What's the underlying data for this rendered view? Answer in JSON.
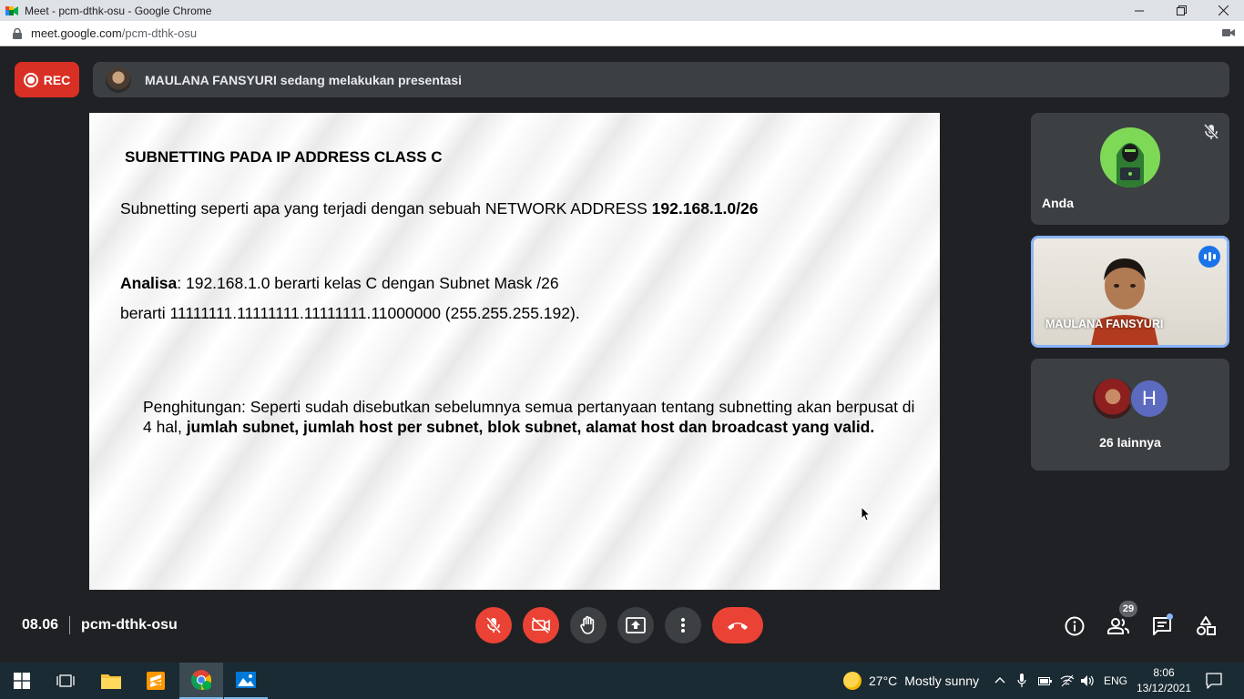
{
  "browser": {
    "window_title": "Meet - pcm-dthk-osu - Google Chrome",
    "url_host": "meet.google.com",
    "url_path": "/pcm-dthk-osu"
  },
  "meet": {
    "rec_label": "REC",
    "presenting_text": "MAULANA FANSYURI sedang melakukan presentasi",
    "time": "08.06",
    "meeting_code": "pcm-dthk-osu",
    "participants_count": "29"
  },
  "slide": {
    "title": "SUBNETTING PADA IP ADDRESS CLASS C",
    "line1_normal": "Subnetting seperti apa yang terjadi dengan sebuah NETWORK ADDRESS ",
    "line1_bold": "192.168.1.0/26",
    "line2_bold": "Analisa",
    "line2_normal": ": 192.168.1.0 berarti kelas C dengan Subnet Mask /26",
    "line3": "berarti 11111111.11111111.11111111.11000000 (255.255.255.192).",
    "para_normal": "Penghitungan: Seperti sudah disebutkan sebelumnya semua pertanyaan tentang subnetting akan berpusat di 4 hal, ",
    "para_bold": "jumlah subnet, jumlah host per subnet, blok subnet, alamat host dan broadcast yang valid."
  },
  "tiles": {
    "you_name": "Anda",
    "presenter_name": "MAULANA FANSYURI",
    "others_initial": "H",
    "others_label": "26 lainnya"
  },
  "taskbar": {
    "weather_temp": "27°C",
    "weather_desc": "Mostly sunny",
    "language": "ENG",
    "clock_time": "8:06",
    "clock_date": "13/12/2021"
  },
  "colors": {
    "meet_bg": "#202124",
    "rec_red": "#d93025",
    "end_call_red": "#ea4335",
    "tile_grey": "#3c4043",
    "speaking_blue": "#1a73e8",
    "taskbar_bg": "#1b2b33"
  }
}
